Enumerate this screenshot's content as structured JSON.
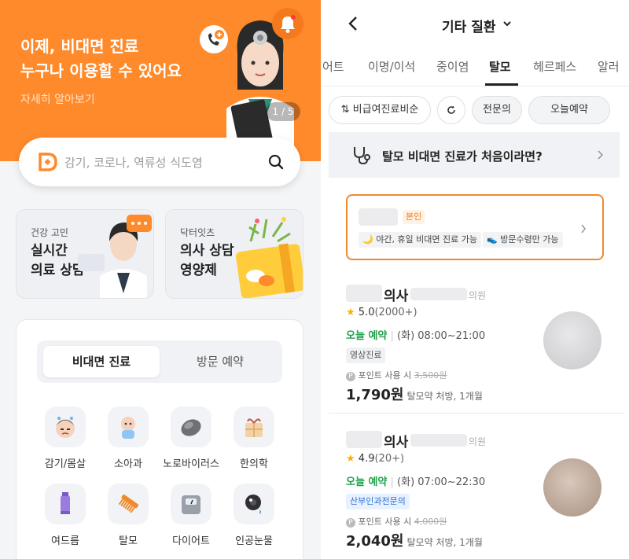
{
  "home": {
    "banner": {
      "headline_line1": "이제, 비대면 진료",
      "headline_line2": "누구나 이용할 수 있어요",
      "more_link": "자세히 알아보기",
      "pager": "1 / 5"
    },
    "search": {
      "placeholder": "감기, 코로나, 역류성 식도염"
    },
    "cards": [
      {
        "sub": "건강 고민",
        "title_line1": "실시간",
        "title_line2": "의료 상담"
      },
      {
        "sub": "닥터잇츠",
        "title_line1": "의사 상담",
        "title_line2": "영양제"
      }
    ],
    "segment": {
      "active": "비대면 진료",
      "inactive": "방문 예약"
    },
    "categories": [
      {
        "label": "감기/몸살",
        "icon": "sick-face-icon"
      },
      {
        "label": "소아과",
        "icon": "baby-icon"
      },
      {
        "label": "노로바이러스",
        "icon": "virus-icon"
      },
      {
        "label": "한의학",
        "icon": "herbal-medicine-icon"
      },
      {
        "label": "여드름",
        "icon": "tube-icon"
      },
      {
        "label": "탈모",
        "icon": "comb-icon"
      },
      {
        "label": "다이어트",
        "icon": "scale-icon"
      },
      {
        "label": "인공눈물",
        "icon": "eye-drop-icon"
      }
    ]
  },
  "list": {
    "header": {
      "title": "기타 질환"
    },
    "tabs": [
      "어트",
      "이명/이석",
      "중이염",
      "탈모",
      "헤르페스",
      "알러"
    ],
    "active_tab": "탈모",
    "filters": [
      "비급여진료비순",
      "전문의",
      "오늘예약"
    ],
    "info_banner": "탈모 비대면 진료가 처음이라면?",
    "self_card": {
      "badge": "본인",
      "pills": [
        "야간, 휴일 비대면 진료 가능",
        "방문수령만 가능"
      ]
    },
    "doctors": [
      {
        "name_suffix": "의사",
        "clinic_suffix": "의원",
        "rating": "5.0",
        "reviews": "(2000+)",
        "today": "오늘 예약",
        "hours": "(화) 08:00~21:00",
        "tag": "영상진료",
        "point_text": "포인트 사용 시",
        "original_price": "3,500원",
        "price": "1,790원",
        "price_note": "탈모약 처방, 1개월"
      },
      {
        "name_suffix": "의사",
        "clinic_suffix": "의원",
        "rating": "4.9",
        "reviews": "(20+)",
        "today": "오늘 예약",
        "hours": "(화) 07:00~22:30",
        "tag": "산부인과전문의",
        "point_text": "포인트 사용 시",
        "original_price": "4,000원",
        "price": "2,040원",
        "price_note": "탈모약 처방, 1개월"
      }
    ]
  },
  "colors": {
    "accent": "#ff8a2b",
    "green": "#1fa24b",
    "blue_tag": "#2b6fd6"
  }
}
